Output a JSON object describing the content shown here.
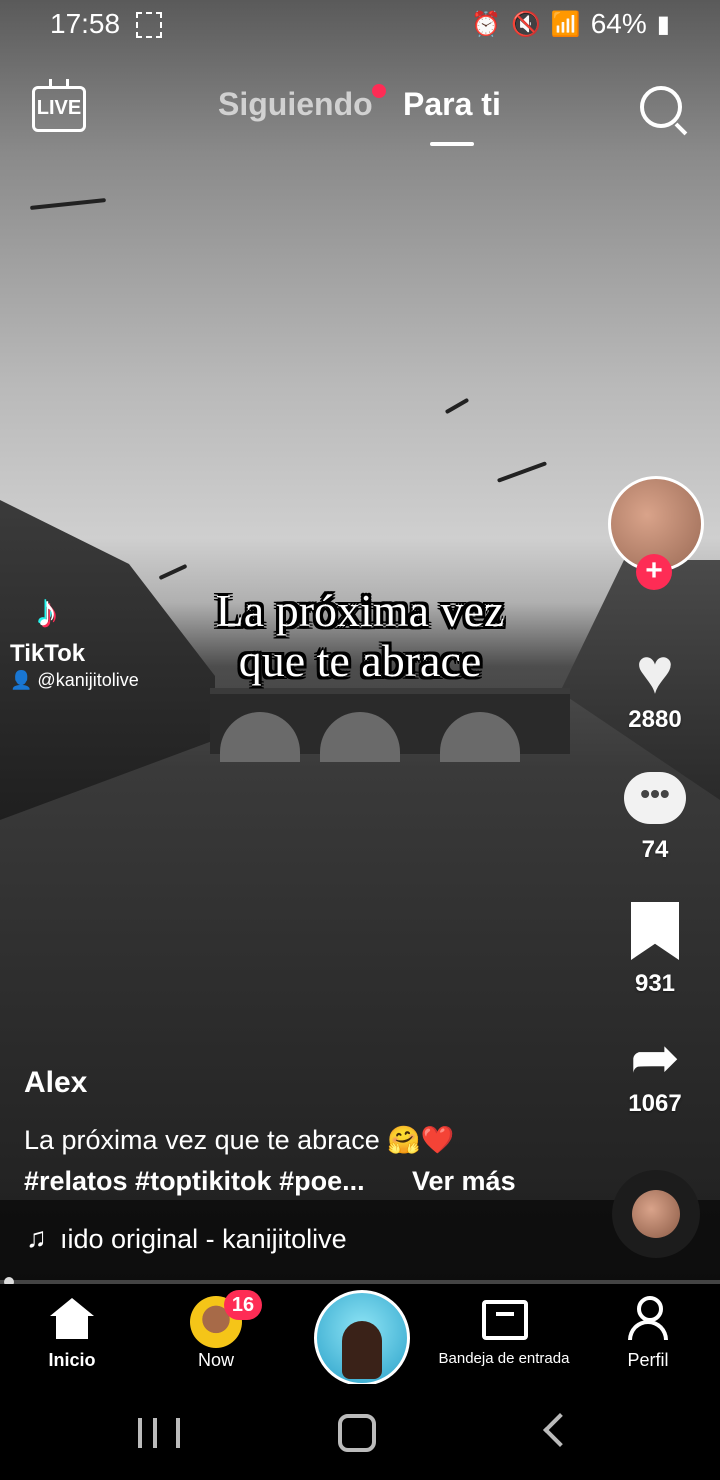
{
  "status_bar": {
    "time": "17:58",
    "battery": "64%",
    "icons": [
      "alarm-icon",
      "mute-icon",
      "wifi-icon",
      "signal-icon",
      "battery-icon"
    ]
  },
  "top_nav": {
    "live_label": "LIVE",
    "tabs": [
      {
        "label": "Siguiendo",
        "active": false,
        "has_dot": true
      },
      {
        "label": "Para ti",
        "active": true
      }
    ]
  },
  "video": {
    "overlay_text_line1": "La próxima vez",
    "overlay_text_line2": "que te abrace",
    "watermark_brand": "TikTok",
    "watermark_handle": "@kanijitolive"
  },
  "actions": {
    "likes": "2880",
    "comments": "74",
    "saves": "931",
    "shares": "1067"
  },
  "post": {
    "author": "Alex",
    "description": "La próxima vez que te abrace 🤗❤️",
    "tags": "#relatos #toptikitok #poe...",
    "see_more": "Ver más",
    "sound": "ıido original - kanijitolive"
  },
  "bottom_nav": {
    "items": [
      {
        "label": "Inicio",
        "active": true
      },
      {
        "label": "Now",
        "badge": "16"
      },
      {
        "label": ""
      },
      {
        "label": "Bandeja de entrada"
      },
      {
        "label": "Perfil"
      }
    ]
  },
  "colors": {
    "accent": "#fe2c55",
    "background": "#000000",
    "text": "#ffffff"
  }
}
